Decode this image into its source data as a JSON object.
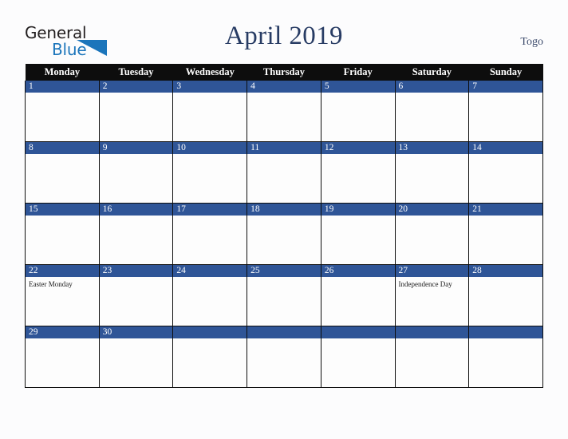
{
  "brand": {
    "name_part1": "General",
    "name_part2": "Blue",
    "triangle_color": "#1b75bb",
    "text_color": "#231f20"
  },
  "header": {
    "title": "April 2019",
    "region": "Togo",
    "title_color": "#283c64"
  },
  "calendar": {
    "weekday_headers": [
      "Monday",
      "Tuesday",
      "Wednesday",
      "Thursday",
      "Friday",
      "Saturday",
      "Sunday"
    ],
    "header_bg": "#0d0d0d",
    "daynum_bg": "#2f5597",
    "cell_bg": "#fdfdfd",
    "weeks": [
      [
        {
          "day": "1",
          "events": []
        },
        {
          "day": "2",
          "events": []
        },
        {
          "day": "3",
          "events": []
        },
        {
          "day": "4",
          "events": []
        },
        {
          "day": "5",
          "events": []
        },
        {
          "day": "6",
          "events": []
        },
        {
          "day": "7",
          "events": []
        }
      ],
      [
        {
          "day": "8",
          "events": []
        },
        {
          "day": "9",
          "events": []
        },
        {
          "day": "10",
          "events": []
        },
        {
          "day": "11",
          "events": []
        },
        {
          "day": "12",
          "events": []
        },
        {
          "day": "13",
          "events": []
        },
        {
          "day": "14",
          "events": []
        }
      ],
      [
        {
          "day": "15",
          "events": []
        },
        {
          "day": "16",
          "events": []
        },
        {
          "day": "17",
          "events": []
        },
        {
          "day": "18",
          "events": []
        },
        {
          "day": "19",
          "events": []
        },
        {
          "day": "20",
          "events": []
        },
        {
          "day": "21",
          "events": []
        }
      ],
      [
        {
          "day": "22",
          "events": [
            "Easter Monday"
          ]
        },
        {
          "day": "23",
          "events": []
        },
        {
          "day": "24",
          "events": []
        },
        {
          "day": "25",
          "events": []
        },
        {
          "day": "26",
          "events": []
        },
        {
          "day": "27",
          "events": [
            "Independence Day"
          ]
        },
        {
          "day": "28",
          "events": []
        }
      ],
      [
        {
          "day": "29",
          "events": []
        },
        {
          "day": "30",
          "events": []
        },
        {
          "day": "",
          "events": []
        },
        {
          "day": "",
          "events": []
        },
        {
          "day": "",
          "events": []
        },
        {
          "day": "",
          "events": []
        },
        {
          "day": "",
          "events": []
        }
      ]
    ]
  }
}
